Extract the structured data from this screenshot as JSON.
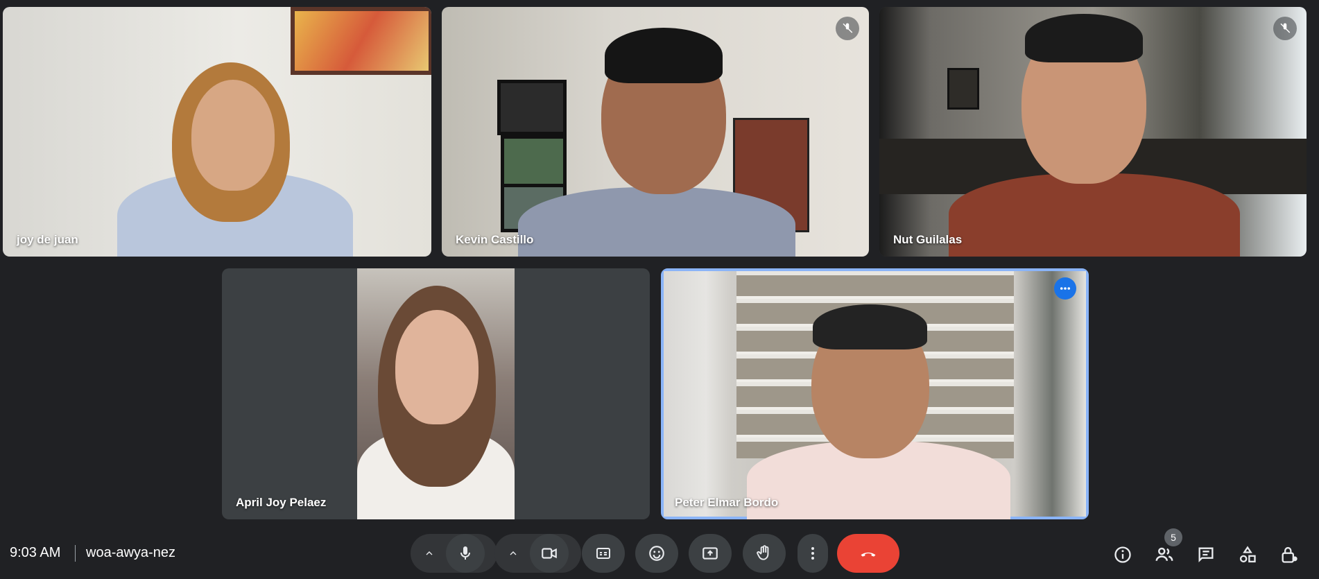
{
  "participants": [
    {
      "name": "joy de juan",
      "muted": false
    },
    {
      "name": "Kevin Castillo",
      "muted": true
    },
    {
      "name": "Nut Guilalas",
      "muted": true
    },
    {
      "name": "April Joy Pelaez",
      "muted": false
    },
    {
      "name": "Peter Elmar Bordo",
      "muted": false,
      "speaking": true
    }
  ],
  "footer": {
    "time": "9:03 AM",
    "meeting_code": "woa-awya-nez",
    "people_count": "5"
  },
  "controls": {
    "mic": "microphone-icon",
    "camera": "camera-icon",
    "captions": "captions-icon",
    "reactions": "emoji-icon",
    "present": "present-screen-icon",
    "raise_hand": "raise-hand-icon",
    "more": "more-vert-icon",
    "leave": "end-call-icon"
  },
  "colors": {
    "background": "#202124",
    "accent": "#8ab4f8",
    "end_call": "#ea4335",
    "menu_button": "#1a73e8"
  }
}
